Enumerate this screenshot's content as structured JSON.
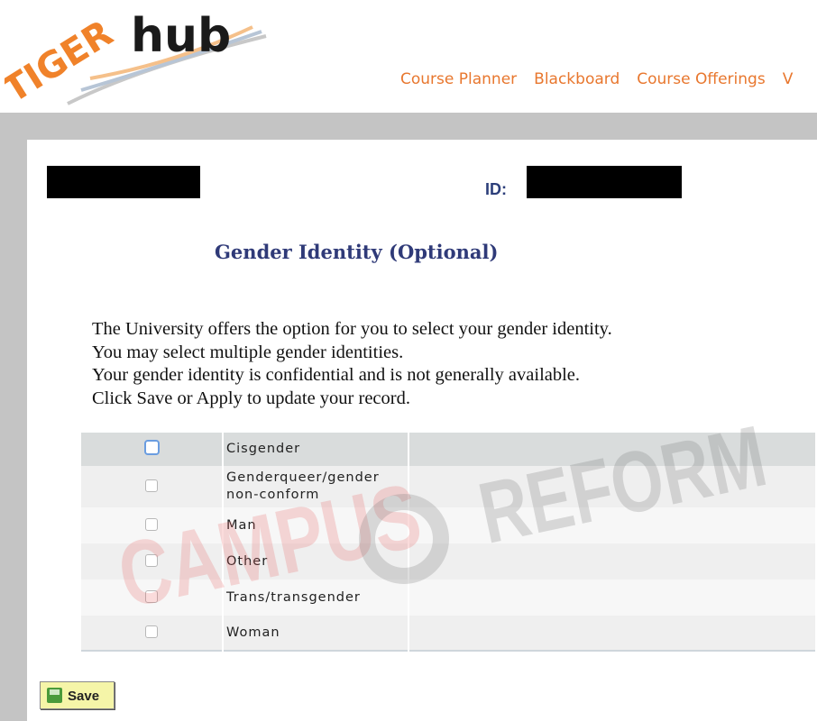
{
  "logo": {
    "text_tiger": "TIGER",
    "text_hub": "hub"
  },
  "nav": [
    "Course Planner",
    "Blackboard",
    "Course Offerings",
    "V"
  ],
  "id_label": "ID:",
  "title": "Gender Identity (Optional)",
  "intro": [
    "The University offers the option for you to select your gender identity.",
    "You may select multiple gender identities.",
    "Your gender identity is confidential and is not generally available.",
    "Click Save or Apply to update your record."
  ],
  "options": [
    {
      "label": "Cisgender",
      "checked": false
    },
    {
      "label": "Genderqueer/gender non-conform",
      "checked": false
    },
    {
      "label": "Man",
      "checked": false
    },
    {
      "label": "Other",
      "checked": false
    },
    {
      "label": "Trans/transgender",
      "checked": false
    },
    {
      "label": "Woman",
      "checked": false
    }
  ],
  "save_label": "Save",
  "watermark": "CAMPUS REFORM",
  "colors": {
    "nav": "#e8772e",
    "title": "#2f3a78",
    "save_bg": "#f5f5a8"
  }
}
